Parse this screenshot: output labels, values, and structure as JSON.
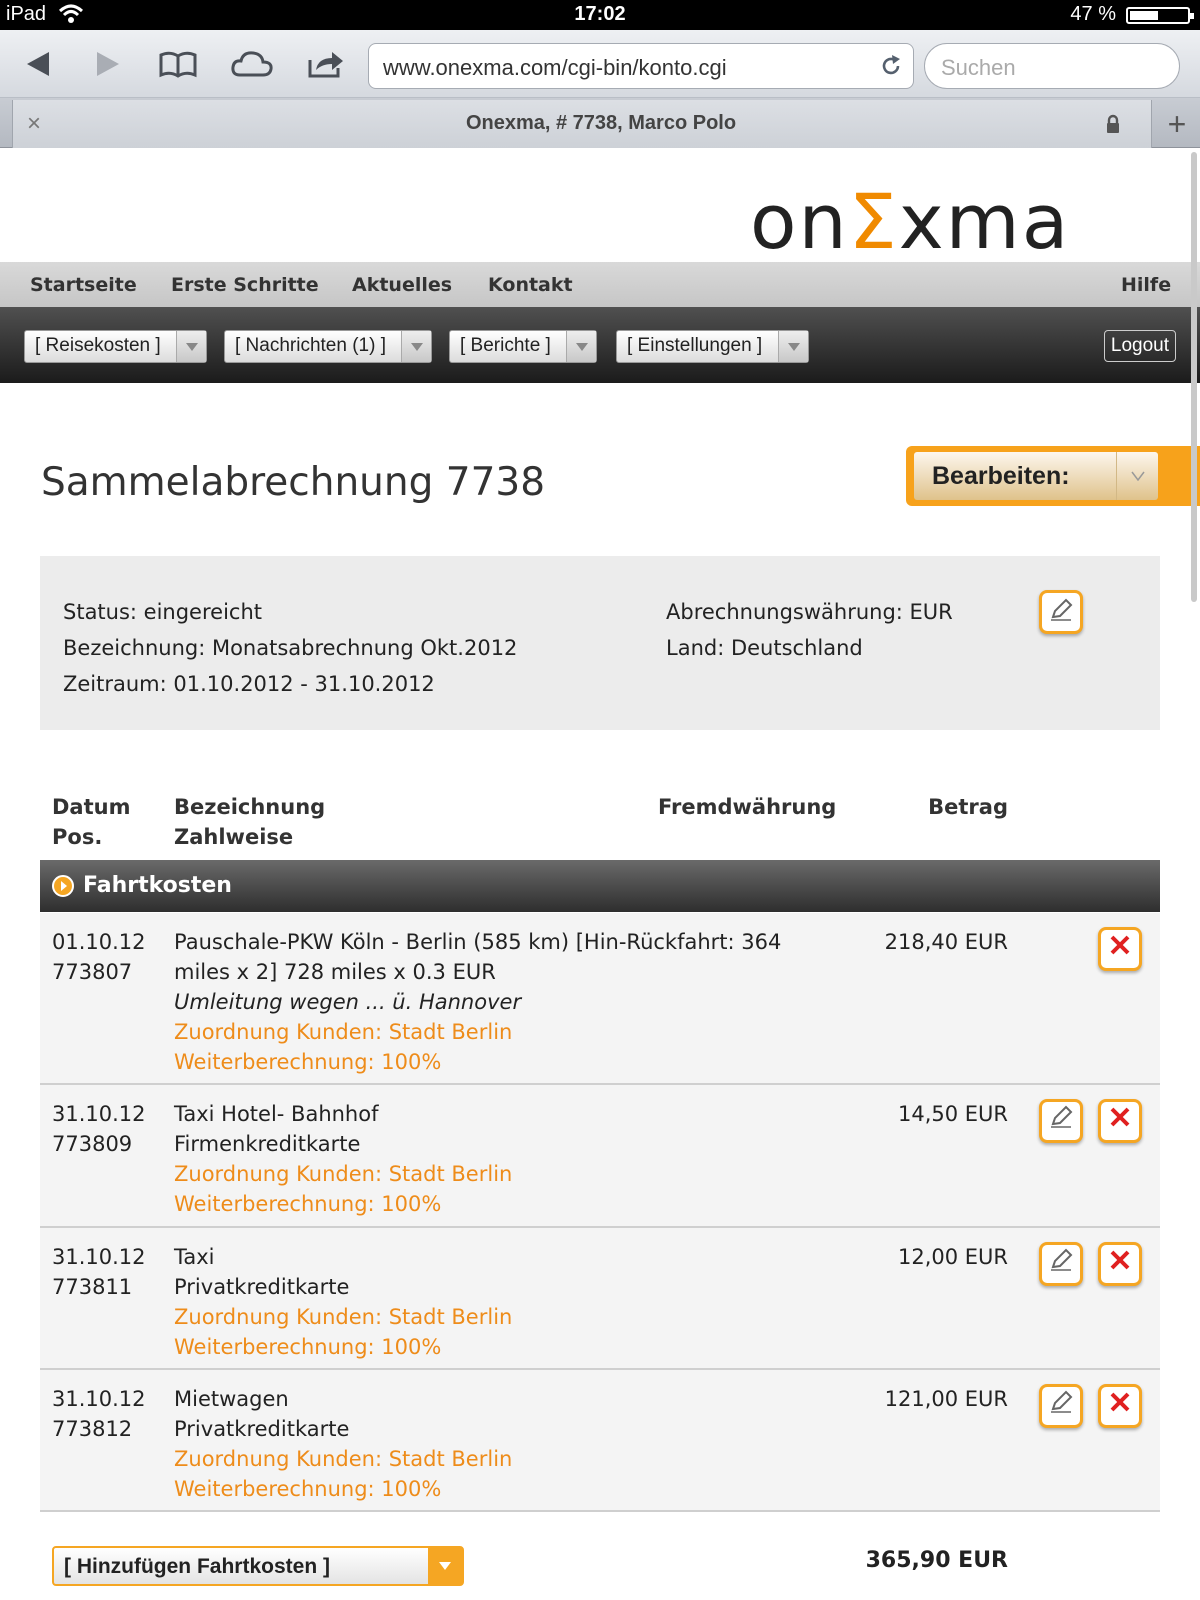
{
  "status_bar": {
    "device": "iPad",
    "time": "17:02",
    "battery": "47 %",
    "battery_level": 0.47
  },
  "browser": {
    "url": "www.onexma.com/cgi-bin/konto.cgi",
    "search_placeholder": "Suchen",
    "tab_title": "Onexma, # 7738, Marco Polo",
    "tab_close": "×",
    "new_tab": "+"
  },
  "logo": {
    "pre": "on",
    "accent": "Σ",
    "post": "xma",
    "accent_color": "#f08a00"
  },
  "nav": {
    "items": [
      "Startseite",
      "Erste Schritte",
      "Aktuelles",
      "Kontakt"
    ],
    "help": "Hilfe"
  },
  "menus": [
    "[ Reisekosten ]",
    "[ Nachrichten (1) ]",
    "[ Berichte ]",
    "[ Einstellungen ]"
  ],
  "logout": "Logout",
  "page": {
    "title": "Sammelabrechnung 7738",
    "action": "Bearbeiten:"
  },
  "info": {
    "status": "Status: eingereicht",
    "bezeichnung": "Bezeichnung: Monatsabrechnung Okt.2012",
    "zeitraum": "Zeitraum: 01.10.2012 - 31.10.2012",
    "waehrung": "Abrechnungswährung: EUR",
    "land": "Land: Deutschland"
  },
  "table": {
    "col1": [
      "Datum",
      "Pos."
    ],
    "col2": [
      "Bezeichnung",
      "Zahlweise"
    ],
    "col3": "Fremdwährung",
    "col4": "Betrag",
    "section": "Fahrtkosten",
    "rows": [
      {
        "date": "01.10.12",
        "pos": "773807",
        "line1": "Pauschale-PKW Köln - Berlin (585 km) [Hin-Rückfahrt: 364",
        "line2": "miles x 2] 728 miles x 0.3 EUR",
        "note": "Umleitung wegen ... ü. Hannover",
        "kunde": "Zuordnung Kunden: Stadt Berlin",
        "weiter": "Weiterberechnung: 100%",
        "amount": "218,40 EUR"
      },
      {
        "date": "31.10.12",
        "pos": "773809",
        "line1": "Taxi Hotel- Bahnhof",
        "line2": "Firmenkreditkarte",
        "kunde": "Zuordnung Kunden: Stadt Berlin",
        "weiter": "Weiterberechnung: 100%",
        "amount": "14,50 EUR"
      },
      {
        "date": "31.10.12",
        "pos": "773811",
        "line1": "Taxi",
        "line2": "Privatkreditkarte",
        "kunde": "Zuordnung Kunden: Stadt Berlin",
        "weiter": "Weiterberechnung: 100%",
        "amount": "12,00 EUR"
      },
      {
        "date": "31.10.12",
        "pos": "773812",
        "line1": "Mietwagen",
        "line2": "Privatkreditkarte",
        "kunde": "Zuordnung Kunden: Stadt Berlin",
        "weiter": "Weiterberechnung: 100%",
        "amount": "121,00 EUR"
      }
    ]
  },
  "add_button": "[ Hinzufügen Fahrtkosten ]",
  "total": "365,90 EUR",
  "colors": {
    "accent": "#f5a623",
    "orange_text": "#ee8c1a",
    "delete": "#e02020"
  }
}
